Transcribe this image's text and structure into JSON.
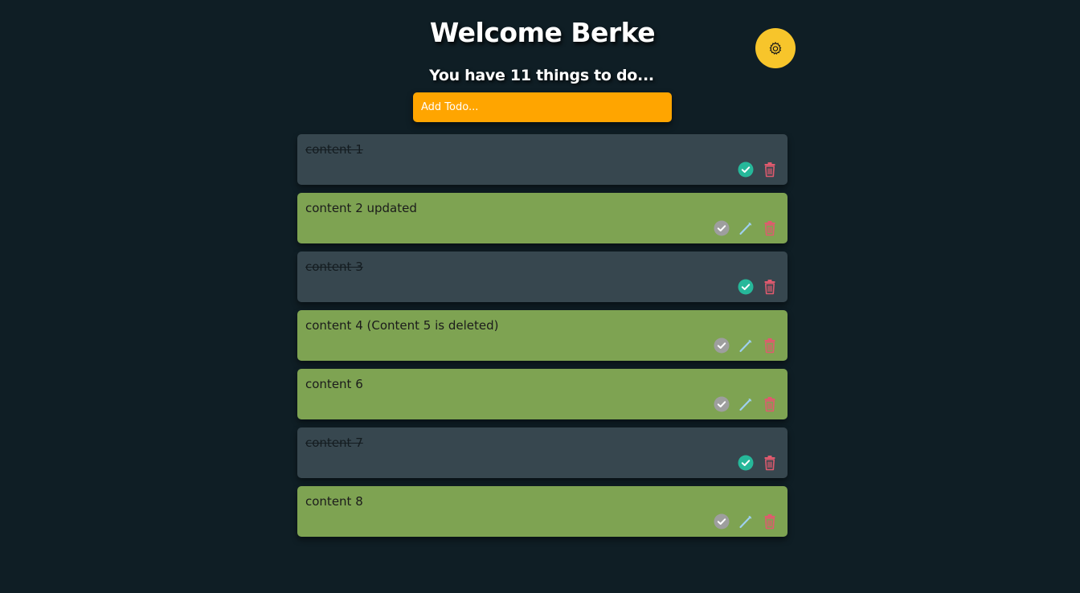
{
  "header": {
    "title": "Welcome Berke",
    "subtitle": "You have 11 things to do..."
  },
  "settings": {
    "icon": "gear-icon",
    "color": "#f7c52b"
  },
  "add_todo": {
    "placeholder": "Add Todo...",
    "value": "",
    "color": "#ffa500"
  },
  "colors": {
    "background": "#0f1e25",
    "done_card": "#37474f",
    "pending_card": "#7ea352",
    "complete_check": "#26b89a",
    "pending_check": "#9e9e9e",
    "edit_icon": "#9fd0f0",
    "delete_icon": "#e05a6e"
  },
  "todos": [
    {
      "text": "content 1",
      "done": true
    },
    {
      "text": "content 2 updated",
      "done": false
    },
    {
      "text": "content 3",
      "done": true
    },
    {
      "text": "content 4 (Content 5 is deleted)",
      "done": false
    },
    {
      "text": "content 6",
      "done": false
    },
    {
      "text": "content 7",
      "done": true
    },
    {
      "text": "content 8",
      "done": false
    }
  ]
}
